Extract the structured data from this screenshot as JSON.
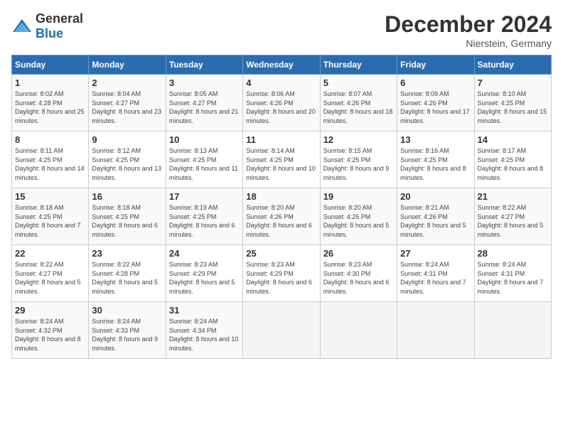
{
  "logo": {
    "general": "General",
    "blue": "Blue"
  },
  "title": "December 2024",
  "location": "Nierstein, Germany",
  "weekdays": [
    "Sunday",
    "Monday",
    "Tuesday",
    "Wednesday",
    "Thursday",
    "Friday",
    "Saturday"
  ],
  "weeks": [
    [
      {
        "day": "1",
        "sunrise": "8:02 AM",
        "sunset": "4:28 PM",
        "daylight": "8 hours and 25 minutes."
      },
      {
        "day": "2",
        "sunrise": "8:04 AM",
        "sunset": "4:27 PM",
        "daylight": "8 hours and 23 minutes."
      },
      {
        "day": "3",
        "sunrise": "8:05 AM",
        "sunset": "4:27 PM",
        "daylight": "8 hours and 21 minutes."
      },
      {
        "day": "4",
        "sunrise": "8:06 AM",
        "sunset": "4:26 PM",
        "daylight": "8 hours and 20 minutes."
      },
      {
        "day": "5",
        "sunrise": "8:07 AM",
        "sunset": "4:26 PM",
        "daylight": "8 hours and 18 minutes."
      },
      {
        "day": "6",
        "sunrise": "8:09 AM",
        "sunset": "4:26 PM",
        "daylight": "8 hours and 17 minutes."
      },
      {
        "day": "7",
        "sunrise": "8:10 AM",
        "sunset": "4:25 PM",
        "daylight": "8 hours and 15 minutes."
      }
    ],
    [
      {
        "day": "8",
        "sunrise": "8:11 AM",
        "sunset": "4:25 PM",
        "daylight": "8 hours and 14 minutes."
      },
      {
        "day": "9",
        "sunrise": "8:12 AM",
        "sunset": "4:25 PM",
        "daylight": "8 hours and 13 minutes."
      },
      {
        "day": "10",
        "sunrise": "8:13 AM",
        "sunset": "4:25 PM",
        "daylight": "8 hours and 11 minutes."
      },
      {
        "day": "11",
        "sunrise": "8:14 AM",
        "sunset": "4:25 PM",
        "daylight": "8 hours and 10 minutes."
      },
      {
        "day": "12",
        "sunrise": "8:15 AM",
        "sunset": "4:25 PM",
        "daylight": "8 hours and 9 minutes."
      },
      {
        "day": "13",
        "sunrise": "8:16 AM",
        "sunset": "4:25 PM",
        "daylight": "8 hours and 8 minutes."
      },
      {
        "day": "14",
        "sunrise": "8:17 AM",
        "sunset": "4:25 PM",
        "daylight": "8 hours and 8 minutes."
      }
    ],
    [
      {
        "day": "15",
        "sunrise": "8:18 AM",
        "sunset": "4:25 PM",
        "daylight": "8 hours and 7 minutes."
      },
      {
        "day": "16",
        "sunrise": "8:18 AM",
        "sunset": "4:25 PM",
        "daylight": "8 hours and 6 minutes."
      },
      {
        "day": "17",
        "sunrise": "8:19 AM",
        "sunset": "4:25 PM",
        "daylight": "8 hours and 6 minutes."
      },
      {
        "day": "18",
        "sunrise": "8:20 AM",
        "sunset": "4:26 PM",
        "daylight": "8 hours and 6 minutes."
      },
      {
        "day": "19",
        "sunrise": "8:20 AM",
        "sunset": "4:26 PM",
        "daylight": "8 hours and 5 minutes."
      },
      {
        "day": "20",
        "sunrise": "8:21 AM",
        "sunset": "4:26 PM",
        "daylight": "8 hours and 5 minutes."
      },
      {
        "day": "21",
        "sunrise": "8:22 AM",
        "sunset": "4:27 PM",
        "daylight": "8 hours and 5 minutes."
      }
    ],
    [
      {
        "day": "22",
        "sunrise": "8:22 AM",
        "sunset": "4:27 PM",
        "daylight": "8 hours and 5 minutes."
      },
      {
        "day": "23",
        "sunrise": "8:22 AM",
        "sunset": "4:28 PM",
        "daylight": "8 hours and 5 minutes."
      },
      {
        "day": "24",
        "sunrise": "8:23 AM",
        "sunset": "4:29 PM",
        "daylight": "8 hours and 5 minutes."
      },
      {
        "day": "25",
        "sunrise": "8:23 AM",
        "sunset": "4:29 PM",
        "daylight": "8 hours and 6 minutes."
      },
      {
        "day": "26",
        "sunrise": "8:23 AM",
        "sunset": "4:30 PM",
        "daylight": "8 hours and 6 minutes."
      },
      {
        "day": "27",
        "sunrise": "8:24 AM",
        "sunset": "4:31 PM",
        "daylight": "8 hours and 7 minutes."
      },
      {
        "day": "28",
        "sunrise": "8:24 AM",
        "sunset": "4:31 PM",
        "daylight": "8 hours and 7 minutes."
      }
    ],
    [
      {
        "day": "29",
        "sunrise": "8:24 AM",
        "sunset": "4:32 PM",
        "daylight": "8 hours and 8 minutes."
      },
      {
        "day": "30",
        "sunrise": "8:24 AM",
        "sunset": "4:33 PM",
        "daylight": "8 hours and 9 minutes."
      },
      {
        "day": "31",
        "sunrise": "8:24 AM",
        "sunset": "4:34 PM",
        "daylight": "8 hours and 10 minutes."
      },
      null,
      null,
      null,
      null
    ]
  ],
  "labels": {
    "sunrise": "Sunrise:",
    "sunset": "Sunset:",
    "daylight": "Daylight:"
  }
}
